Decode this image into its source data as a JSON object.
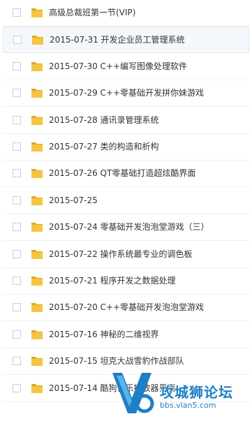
{
  "rows": [
    {
      "name": "高级总裁班第一节(VIP)"
    },
    {
      "name": "2015-07-31 开发企业员工管理系统"
    },
    {
      "name": "2015-07-30 C++编写图像处理软件"
    },
    {
      "name": "2015-07-29 C++零基础开发拼你妹游戏"
    },
    {
      "name": "2015-07-28 通讯录管理系统"
    },
    {
      "name": "2015-07-27 类的构造和析构"
    },
    {
      "name": "2015-07-26 QT零基础打造超炫酷界面"
    },
    {
      "name": "2015-07-25"
    },
    {
      "name": "2015-07-24 零基础开发泡泡堂游戏（三）"
    },
    {
      "name": "2015-07-22 操作系统最专业的调色板"
    },
    {
      "name": "2015-07-21 程序开发之数据处理"
    },
    {
      "name": "2015-07-20 C++零基础开发泡泡堂游戏"
    },
    {
      "name": "2015-07-16 神秘的二维视界"
    },
    {
      "name": "2015-07-15 坦克大战雪豹作战部队"
    },
    {
      "name": "2015-07-14 酷狗音乐播放器界面"
    }
  ],
  "icons": {
    "checkbox": "checkbox",
    "folder": "folder-icon"
  },
  "colors": {
    "folder": "#f5c542",
    "folder_dark": "#e0a82a",
    "hover_row": "#f4f7fb",
    "watermark": "#1e7fc4"
  },
  "watermark": {
    "title": "攻城狮论坛",
    "url": "bbs.vlan5.com"
  }
}
